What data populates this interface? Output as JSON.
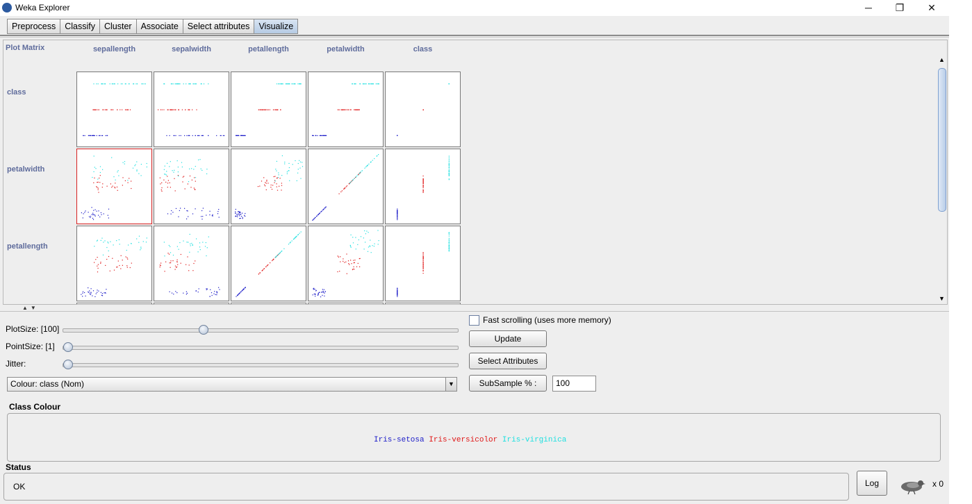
{
  "window": {
    "title": "Weka Explorer",
    "controls": {
      "minimize": "─",
      "restore": "❐",
      "close": "✕"
    }
  },
  "tabs": [
    {
      "label": "Preprocess"
    },
    {
      "label": "Classify"
    },
    {
      "label": "Cluster"
    },
    {
      "label": "Associate"
    },
    {
      "label": "Select attributes"
    },
    {
      "label": "Visualize",
      "active": true
    }
  ],
  "plot_matrix": {
    "title": "Plot Matrix",
    "columns": [
      "sepallength",
      "sepalwidth",
      "petallength",
      "petalwidth",
      "class"
    ],
    "rows": [
      "class",
      "petalwidth",
      "petallength"
    ],
    "selected_cell": {
      "row": "petalwidth",
      "column": "sepallength"
    }
  },
  "controls": {
    "plotsize_label": "PlotSize: [100]",
    "plotsize_level": 0.35,
    "pointsize_label": "PointSize: [1]",
    "pointsize_level": 0,
    "jitter_label": "Jitter:",
    "jitter_level": 0,
    "colour_select": "Colour: class  (Nom)",
    "fast_scrolling_label": "Fast scrolling (uses more memory)",
    "fast_scrolling_checked": false,
    "update_button": "Update",
    "select_attributes_button": "Select Attributes",
    "subsample_button": "SubSample % :",
    "subsample_value": "100"
  },
  "class_colour": {
    "title": "Class Colour",
    "entries": [
      {
        "label": "Iris-setosa",
        "color": "#1c1cc8"
      },
      {
        "label": "Iris-versicolor",
        "color": "#e01818"
      },
      {
        "label": "Iris-virginica",
        "color": "#1ee0e0"
      }
    ]
  },
  "status": {
    "title": "Status",
    "text": "OK",
    "log_button": "Log",
    "task_count": "x 0"
  }
}
